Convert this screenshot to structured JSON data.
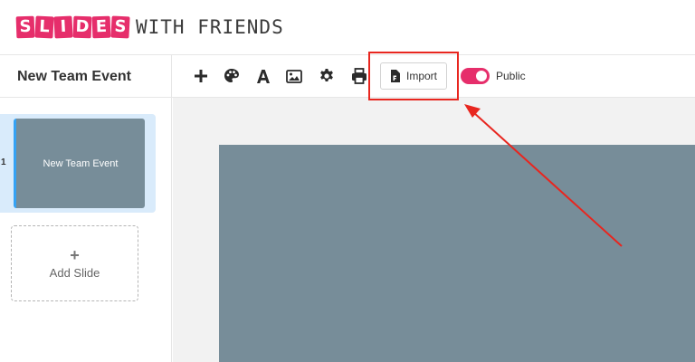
{
  "brand": {
    "logo_tiles": [
      "S",
      "L",
      "I",
      "D",
      "E",
      "S"
    ],
    "logo_rest": "WITH FRIENDS"
  },
  "toolbar": {
    "doc_title": "New Team Event",
    "tools": [
      {
        "name": "add-icon"
      },
      {
        "name": "palette-icon"
      },
      {
        "name": "text-icon"
      },
      {
        "name": "image-icon"
      },
      {
        "name": "settings-gear-icon"
      },
      {
        "name": "print-icon"
      }
    ],
    "import_label": "Import",
    "toggle_label": "Public",
    "toggle_on": true
  },
  "sidebar": {
    "slides": [
      {
        "number": "1",
        "title": "New Team Event"
      }
    ],
    "add_slide_plus": "+",
    "add_slide_label": "Add Slide"
  },
  "colors": {
    "brand_pink": "#e62e6b",
    "slide_bg": "#778d99",
    "selected_slide_bg": "#d9ebfb",
    "annotation_red": "#e8261f"
  }
}
